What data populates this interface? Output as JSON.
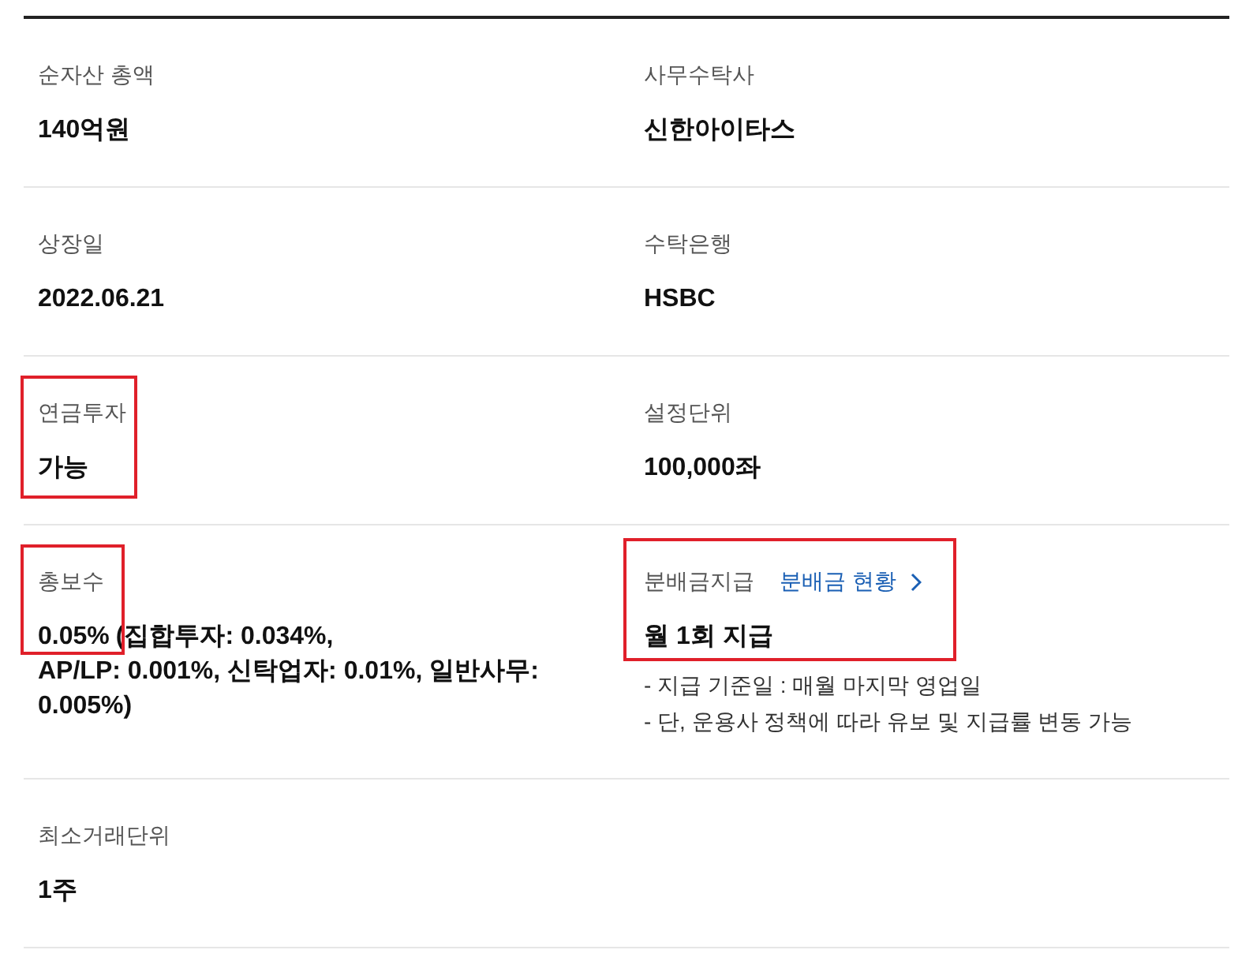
{
  "rows": [
    {
      "cells": [
        {
          "label": "순자산 총액",
          "value": "140억원",
          "highlight": false
        },
        {
          "label": "사무수탁사",
          "value": "신한아이타스",
          "highlight": false
        }
      ]
    },
    {
      "cells": [
        {
          "label": "상장일",
          "value": "2022.06.21",
          "highlight": false
        },
        {
          "label": "수탁은행",
          "value": "HSBC",
          "highlight": false
        }
      ]
    },
    {
      "cells": [
        {
          "label": "연금투자",
          "value": "가능",
          "highlight": true
        },
        {
          "label": "설정단위",
          "value": "100,000좌",
          "highlight": false
        }
      ]
    },
    {
      "cells": [
        {
          "label": "총보수",
          "value": "0.05%",
          "value_detail": [
            "(집합투자: 0.034%,",
            "AP/LP: 0.001%, 신탁업자: 0.01%, 일반사무: 0.005%)"
          ],
          "highlight": true
        },
        {
          "label": "분배금지급",
          "link": "분배금 현황",
          "value": "월 1회 지급",
          "notes": [
            "- 지급 기준일 : 매월 마지막 영업일",
            "- 단, 운용사 정책에 따라 유보 및 지급률 변동 가능"
          ],
          "highlight": true
        }
      ]
    },
    {
      "cells": [
        {
          "label": "최소거래단위",
          "value": "1주",
          "highlight": false
        }
      ]
    }
  ]
}
